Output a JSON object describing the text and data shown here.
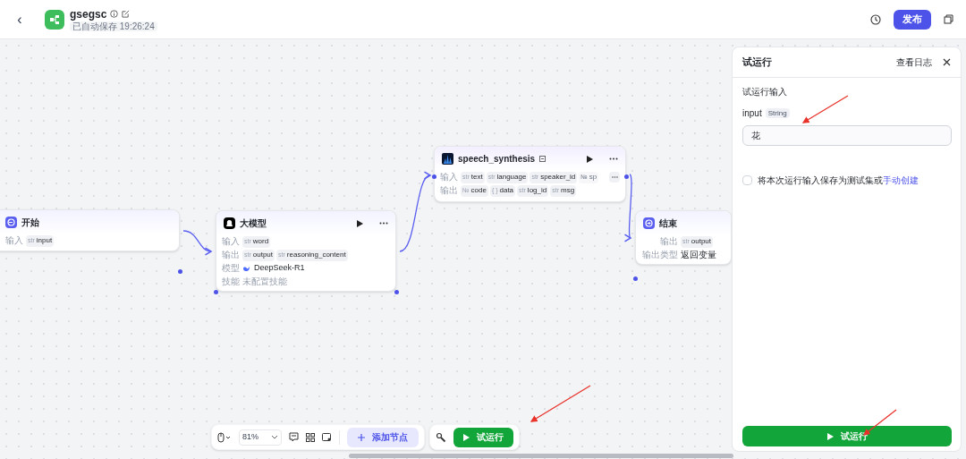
{
  "header": {
    "back": "‹",
    "app_name": "gsegsc",
    "autosave": "已自动保存 19:26:24",
    "publish": "发布"
  },
  "nodes": [
    {
      "kind": "start",
      "title": "开始",
      "actions": false,
      "rows": [
        {
          "kind": "vars",
          "label": "输入",
          "overflow": false,
          "vars": [
            {
              "type": "str",
              "name": "input",
              "faded": false
            }
          ]
        }
      ]
    },
    {
      "kind": "llm",
      "title": "大模型",
      "actions": true,
      "rows": [
        {
          "kind": "vars",
          "label": "输入",
          "overflow": false,
          "vars": [
            {
              "type": "str",
              "name": "word",
              "faded": false
            }
          ]
        },
        {
          "kind": "vars",
          "label": "输出",
          "overflow": false,
          "vars": [
            {
              "type": "str",
              "name": "output",
              "faded": false
            },
            {
              "type": "str",
              "name": "reasoning_content",
              "faded": false
            }
          ]
        },
        {
          "kind": "model",
          "label": "模型",
          "value": "DeepSeek-R1"
        },
        {
          "kind": "text",
          "label": "技能",
          "value": "未配置技能"
        }
      ]
    },
    {
      "kind": "plugin",
      "title": "speech_synthesis",
      "actions": true,
      "rows": [
        {
          "kind": "vars",
          "label": "输入",
          "overflow": true,
          "vars": [
            {
              "type": "str",
              "name": "text",
              "faded": false
            },
            {
              "type": "str",
              "name": "language",
              "faded": false
            },
            {
              "type": "str",
              "name": "speaker_id",
              "faded": false
            },
            {
              "type": "№",
              "name": "sp",
              "faded": true
            }
          ]
        },
        {
          "kind": "vars",
          "label": "输出",
          "overflow": false,
          "vars": [
            {
              "type": "№",
              "name": "code",
              "faded": false
            },
            {
              "type": "{ }",
              "name": "data",
              "faded": false
            },
            {
              "type": "str",
              "name": "log_id",
              "faded": false
            },
            {
              "type": "str",
              "name": "msg",
              "faded": false
            }
          ]
        }
      ]
    },
    {
      "kind": "end",
      "title": "结束",
      "actions": false,
      "rows": [
        {
          "kind": "vars",
          "label": "输出",
          "overflow": false,
          "vars": [
            {
              "type": "str",
              "name": "output",
              "faded": false
            }
          ]
        },
        {
          "kind": "text",
          "label": "输出类型",
          "value": "返回变量"
        }
      ]
    }
  ],
  "toolbar": {
    "zoom": "81%",
    "add_node": "添加节点",
    "run": "试运行"
  },
  "panel": {
    "title": "试运行",
    "log_link": "查看日志",
    "section": "试运行输入",
    "field": {
      "label": "input",
      "type": "String",
      "value": "花"
    },
    "save_option": {
      "checked": false,
      "text": "将本次运行输入保存为测试集或",
      "link": "手动创建"
    },
    "run_button": "试运行"
  }
}
